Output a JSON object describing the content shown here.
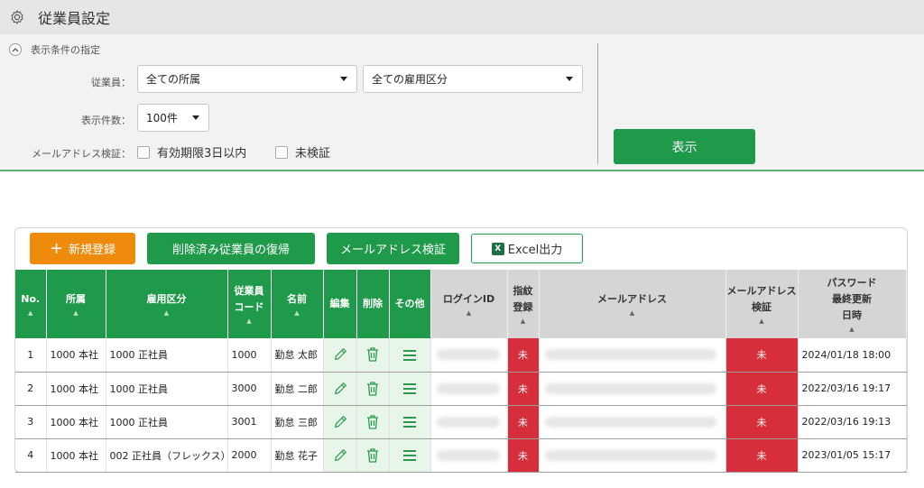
{
  "header": {
    "title": "従業員設定",
    "icon": "gear-icon"
  },
  "filter": {
    "section_title": "表示条件の指定",
    "employee_label": "従業員：",
    "affiliation_select": "全ての所属",
    "employment_select": "全ての雇用区分",
    "count_label": "表示件数：",
    "count_select": "100件",
    "email_label": "メールアドレス検証：",
    "checkbox_expiring": "有効期限3日以内",
    "checkbox_unverified": "未検証",
    "show_button": "表示"
  },
  "toolbar": {
    "new_button": "新規登録",
    "restore_button": "削除済み従業員の復帰",
    "verify_button": "メールアドレス検証",
    "excel_button": "Excel出力"
  },
  "table": {
    "columns": {
      "no": "No.",
      "affiliation": "所属",
      "employment": "雇用区分",
      "code_1": "従業員",
      "code_2": "コード",
      "name": "名前",
      "edit": "編集",
      "delete": "削除",
      "other": "その他",
      "login": "ログインID",
      "finger_1": "指紋",
      "finger_2": "登録",
      "email": "メールアドレス",
      "verify_1": "メールアドレス",
      "verify_2": "検証",
      "pw_1": "パスワード",
      "pw_2": "最終更新",
      "pw_3": "日時"
    },
    "rows": [
      {
        "no": "1",
        "affiliation": "1000 本社",
        "employment": "1000 正社員",
        "code": "1000",
        "name": "勤怠 太郎",
        "finger": "未",
        "verify": "未",
        "pw_updated": "2024/01/18 18:00"
      },
      {
        "no": "2",
        "affiliation": "1000 本社",
        "employment": "1000 正社員",
        "code": "3000",
        "name": "勤怠 二郎",
        "finger": "未",
        "verify": "未",
        "pw_updated": "2022/03/16 19:17"
      },
      {
        "no": "3",
        "affiliation": "1000 本社",
        "employment": "1000 正社員",
        "code": "3001",
        "name": "勤怠 三郎",
        "finger": "未",
        "verify": "未",
        "pw_updated": "2022/03/16 19:13"
      },
      {
        "no": "4",
        "affiliation": "1000 本社",
        "employment": "002 正社員（フレックス）",
        "code": "2000",
        "name": "勤怠 花子",
        "finger": "未",
        "verify": "未",
        "pw_updated": "2023/01/05 15:17"
      }
    ]
  },
  "colors": {
    "green": "#1f9a4a",
    "orange": "#ee8a0c",
    "red": "#d62e3a"
  }
}
